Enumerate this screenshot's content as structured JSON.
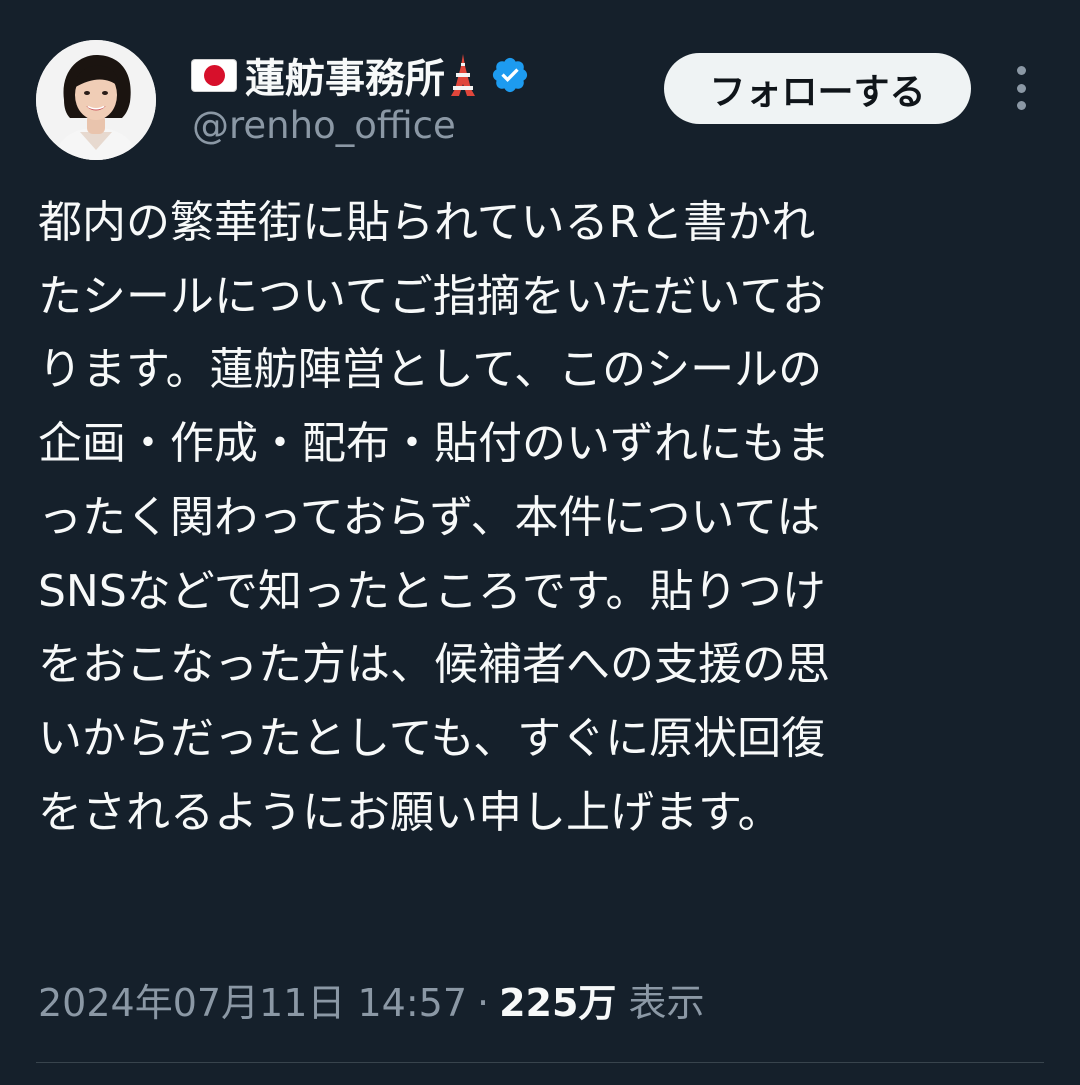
{
  "author": {
    "flag_icon": "japan-flag-icon",
    "name": "蓮舫事務所",
    "name_suffix_icon": "tokyo-tower-icon",
    "verified_icon": "verified-badge-icon",
    "handle": "@renho_office"
  },
  "follow_button": {
    "label": "フォローする"
  },
  "more_menu_icon": "more-vertical-icon",
  "tweet": {
    "lines": [
      "都内の繁華街に貼られているRと書かれ",
      "たシールについてご指摘をいただいてお",
      "ります。蓮舫陣営として、このシールの",
      "企画・作成・配布・貼付のいずれにもま",
      "ったく関わっておらず、本件については",
      "SNSなどで知ったところです。貼りつけ",
      "をおこなった方は、候補者への支援の思",
      "いからだったとしても、すぐに原状回復",
      "をされるようにお願い申し上げます。"
    ]
  },
  "meta": {
    "timestamp": "2024年07月11日 14:57",
    "separator": "·",
    "views": "225万",
    "views_label": "表示"
  },
  "colors": {
    "background": "#15202b",
    "text": "#f7f9f9",
    "muted": "#8b98a5",
    "verified": "#1d9bf0",
    "button_bg": "#eff3f4",
    "divider": "#38444d"
  }
}
